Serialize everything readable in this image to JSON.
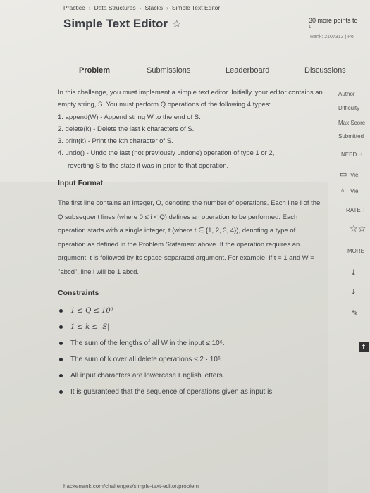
{
  "breadcrumb": [
    "Practice",
    "Data Structures",
    "Stacks",
    "Simple Text Editor"
  ],
  "page_title": "Simple Text Editor",
  "points": {
    "text": "30 more points to",
    "sub": "1"
  },
  "rank": "Rank: 2107313  |  Po",
  "tabs": [
    "Problem",
    "Submissions",
    "Leaderboard",
    "Discussions"
  ],
  "intro": "In this challenge, you must implement a simple text editor. Initially, your editor contains an empty string, S. You must perform Q operations of the following 4 types:",
  "operations": [
    {
      "line1": "1. append(W) - Append string W to the end of S.",
      "line2": ""
    },
    {
      "line1": "2. delete(k) - Delete the last k characters of S.",
      "line2": ""
    },
    {
      "line1": "3. print(k) - Print the kth character of S.",
      "line2": ""
    },
    {
      "line1": "4. undo() - Undo the last (not previously undone) operation of type 1 or 2,",
      "line2": "reverting S to the state it was in prior to that operation."
    }
  ],
  "input_format": {
    "heading": "Input Format",
    "text": "The first line contains an integer, Q, denoting the number of operations. Each line i of the Q subsequent lines (where 0 ≤ i < Q) defines an operation to be performed. Each operation starts with a single integer, t (where t ∈ {1, 2, 3, 4}), denoting a type of operation as defined in the Problem Statement above. If the operation requires an argument, t is followed by its space-separated argument. For example, if t = 1 and W = \"abcd\", line i will be 1 abcd."
  },
  "constraints": {
    "heading": "Constraints",
    "items": [
      "1 ≤ Q ≤ 10⁶",
      "1 ≤ k ≤ |S|",
      "The sum of the lengths of all W in the input ≤ 10⁶.",
      "The sum of k over all delete operations ≤ 2 · 10⁶.",
      "All input characters are lowercase English letters.",
      "It is guaranteed that the sequence of operations given as input is"
    ]
  },
  "sidebar": {
    "author": "Author",
    "difficulty": "Difficulty",
    "max_score": "Max Score",
    "submitted": "Submitted",
    "need_help": "NEED H",
    "view1": "Vie",
    "view2": "Vie",
    "rate": "RATE T",
    "more": "MORE"
  },
  "url": "hackerrank.com/challenges/simple-text-editor/problem"
}
